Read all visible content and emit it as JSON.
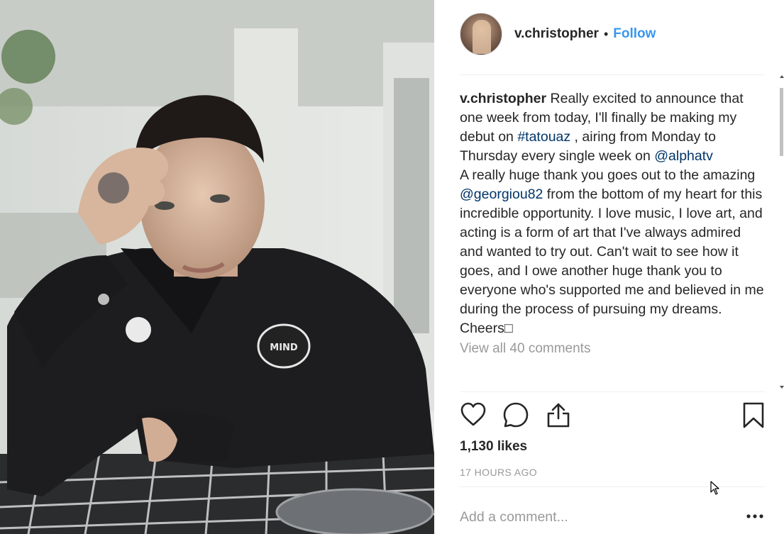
{
  "post": {
    "photo_icon": "post-photo",
    "username": "v.christopher",
    "separator": "•",
    "follow_label": "Follow",
    "caption": {
      "username": "v.christopher",
      "text_1": " Really excited to announce that one week from today, I'll finally be making my debut on ",
      "hashtag": "#tatouaz",
      "text_2": " , airing from Monday to Thursday every single week on ",
      "mention_1": "@alphatv",
      "text_3": "A really huge thank you goes out to the amazing ",
      "mention_2": "@georgiou82",
      "text_4": " from the bottom of my heart for this incredible opportunity. I love music, I love art, and acting is a form of art that I've always admired and wanted to try out. Can't wait to see how it goes, and I owe another huge thank you to everyone who's supported me and believed in me during the process of pursuing my dreams. Cheers",
      "trailing_glyph": "□"
    },
    "view_all_comments": "View all 40 comments",
    "likes": "1,130 likes",
    "timestamp": "17 HOURS AGO",
    "comment_placeholder": "Add a comment...",
    "icons": {
      "like": "heart-icon",
      "comment": "comment-icon",
      "share": "share-icon",
      "save": "bookmark-icon",
      "more": "more-options-icon"
    }
  },
  "colors": {
    "link": "#003569",
    "follow": "#3897f0",
    "muted": "#999999",
    "text": "#262626"
  }
}
